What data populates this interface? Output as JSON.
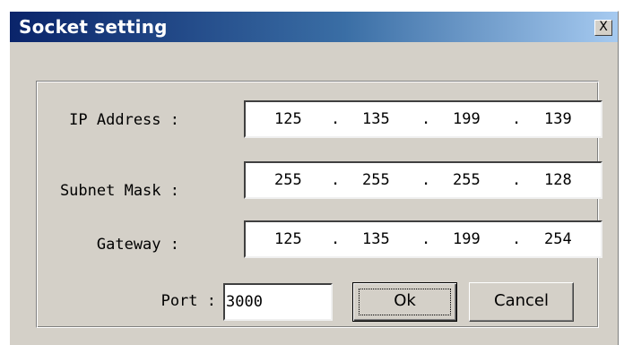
{
  "window": {
    "title": "Socket setting",
    "close_label": "X"
  },
  "fields": {
    "ip_address": {
      "label": "IP Address :",
      "octets": [
        "125",
        "135",
        "199",
        "139"
      ],
      "separator": "."
    },
    "subnet_mask": {
      "label": "Subnet Mask :",
      "octets": [
        "255",
        "255",
        "255",
        "128"
      ],
      "separator": "."
    },
    "gateway": {
      "label": "Gateway :",
      "octets": [
        "125",
        "135",
        "199",
        "254"
      ],
      "separator": "."
    },
    "port": {
      "label": "Port :",
      "value": "3000"
    }
  },
  "buttons": {
    "ok_label": "Ok",
    "cancel_label": "Cancel"
  },
  "colors": {
    "dialog_face": "#d4d0c8",
    "titlebar_start": "#0a246a",
    "titlebar_end": "#a6caf0",
    "title_text": "#ffffff"
  }
}
